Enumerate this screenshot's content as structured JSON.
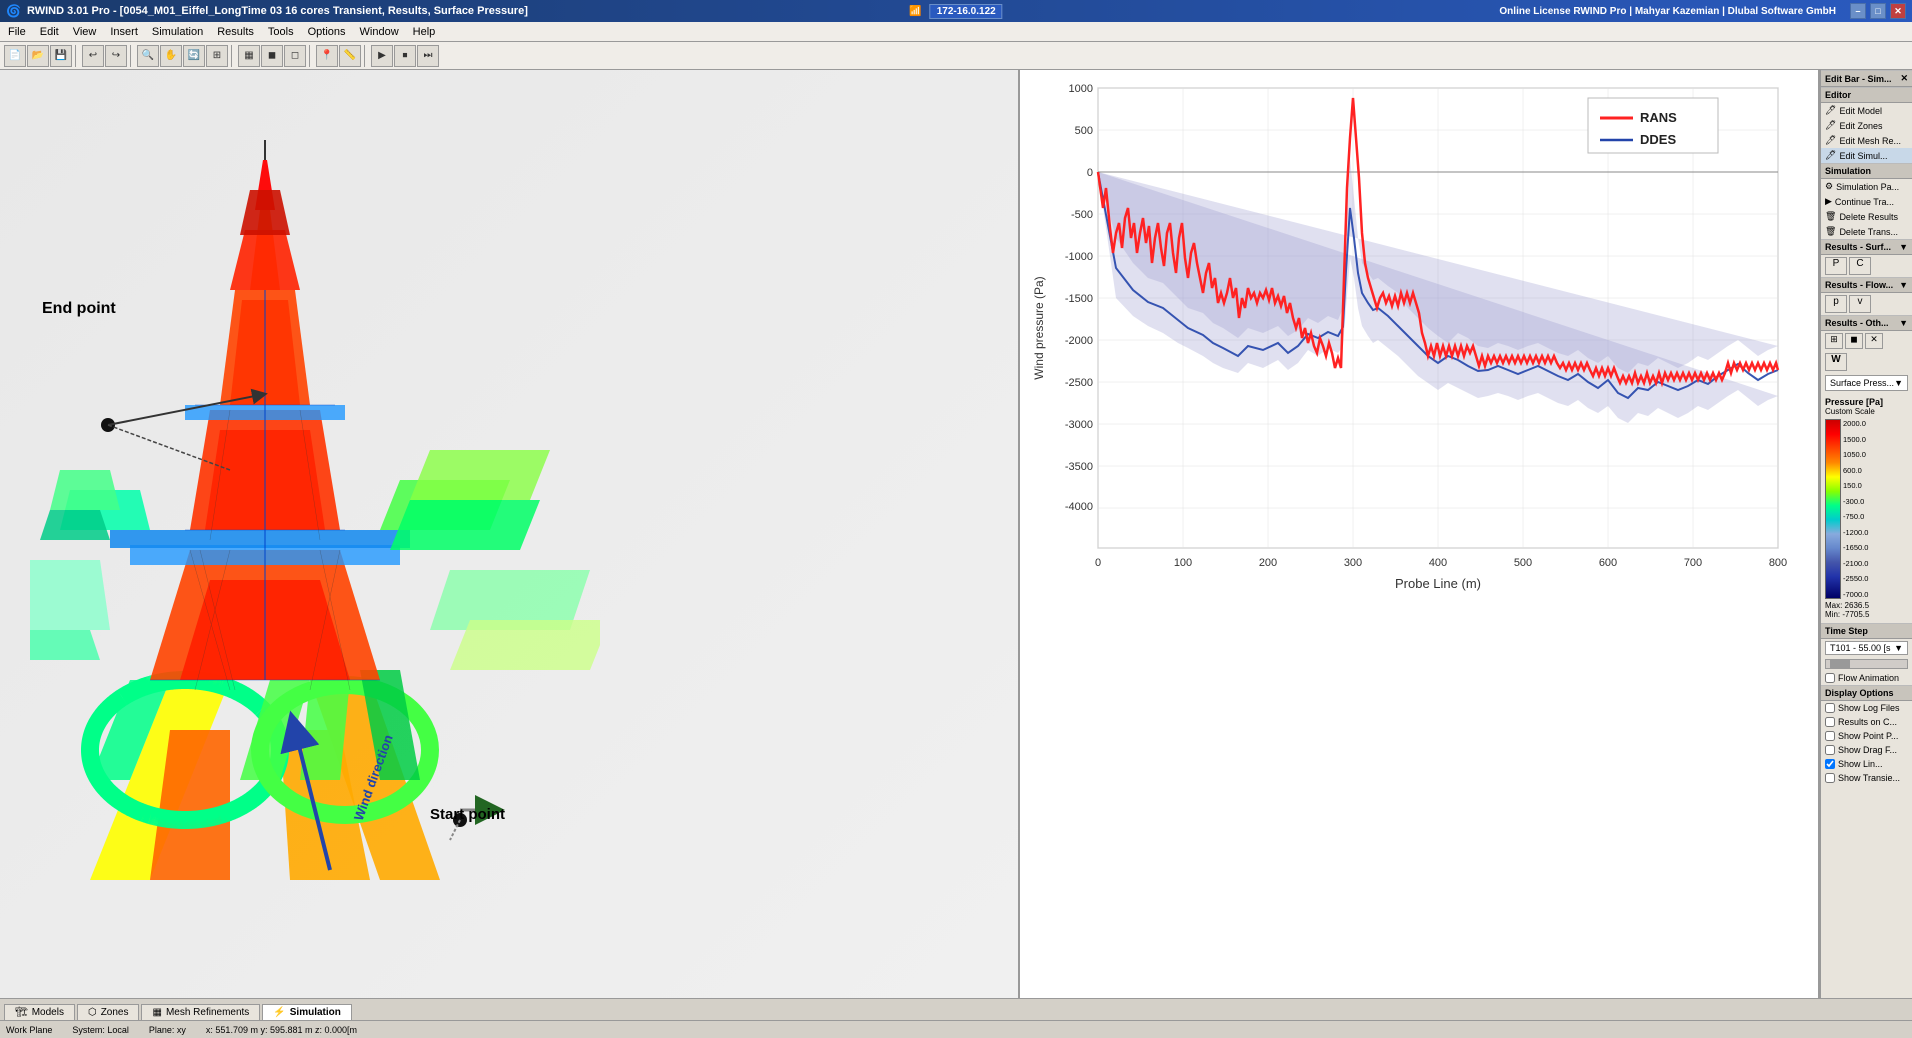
{
  "titleBar": {
    "title": "RWIND 3.01 Pro - [0054_M01_Eiffel_LongTime 03 16 cores Transient, Results, Surface Pressure]",
    "network": "172-16.0.122",
    "rightTitle": "Online License RWIND Pro | Mahyar Kazemian | Dlubal Software GmbH",
    "minimizeBtn": "–",
    "maximizeBtn": "□",
    "closeBtn": "✕"
  },
  "menuBar": {
    "items": [
      "File",
      "Edit",
      "View",
      "Insert",
      "Simulation",
      "Results",
      "Tools",
      "Options",
      "Window",
      "Help"
    ]
  },
  "sidebar": {
    "editSection": "Edit Bar - Sim...",
    "editorTitle": "Editor",
    "editItems": [
      "Edit Model",
      "Edit Zones",
      "Edit Mesh Re...",
      "Edit Simul..."
    ],
    "simulationTitle": "Simulation",
    "simItems": [
      "Simulation Pa...",
      "Continue Tra...",
      "Delete Results",
      "Delete Trans..."
    ],
    "resultsSection": "Results - Surf...",
    "resultsFlow": "Results - Flow...",
    "resultsOther": "Results - Oth...",
    "surfacePressureLabel": "Surface Press...",
    "pressureLabel": "Pressure [Pa]",
    "scaleLabel": "Custom Scale",
    "scaleValues": [
      "2000.0",
      "1500.0",
      "1050.0",
      "600.0",
      "150.0",
      "-300.0",
      "-750.0",
      "-1200.0",
      "-1650.0",
      "-2100.0",
      "-2550.0",
      "-7000.0"
    ],
    "maxValue": "Max: 2636.5",
    "minValue": "Min: -7705.5",
    "timeStepLabel": "Time Step",
    "timeStepValue": "T101 - 55.00 [s",
    "flowAnimation": "Flow Animation",
    "displayOptions": "Display Options",
    "checkItems": [
      "Show Log Files",
      "Results on C...",
      "Show Point P...",
      "Show Drag F...",
      "Show Lin...",
      "Show Transie..."
    ],
    "checkedItems": [
      false,
      false,
      false,
      false,
      true,
      false
    ]
  },
  "viewPanel": {
    "endPointLabel": "End point",
    "startPointLabel": "Start point",
    "windDirectionLabel": "Wind direction",
    "workPlane": "Work Plane"
  },
  "chart": {
    "title": "",
    "xLabel": "Probe Line (m)",
    "yLabel": "Wind pressure (Pa)",
    "xMin": 0,
    "xMax": 800,
    "yMin": -4000,
    "yMax": 1000,
    "xTicks": [
      0,
      100,
      200,
      300,
      400,
      500,
      600,
      700,
      800
    ],
    "yTicks": [
      1000,
      500,
      0,
      -500,
      -1000,
      -1500,
      -2000,
      -2500,
      -3000,
      -3500,
      -4000
    ],
    "legend": [
      {
        "label": "RANS",
        "color": "#ff2222",
        "lineWidth": 3
      },
      {
        "label": "DDES",
        "color": "#2244aa",
        "lineWidth": 2
      }
    ]
  },
  "statusBar": {
    "system": "System: Local",
    "plane": "Plane: xy",
    "coordinates": "x: 551.709 m  y: 595.881 m  z: 0.000[m",
    "workPlane": "Work Plane"
  },
  "tabs": {
    "items": [
      "Models",
      "Zones",
      "Mesh Refinements",
      "Simulation"
    ],
    "activeIndex": 3
  },
  "colors": {
    "accent": "#316ac5",
    "titleBg": "#1a3a6b",
    "sidebarBg": "#e8e4dc",
    "chartRed": "#ff2222",
    "chartBlue": "#2244aa"
  }
}
